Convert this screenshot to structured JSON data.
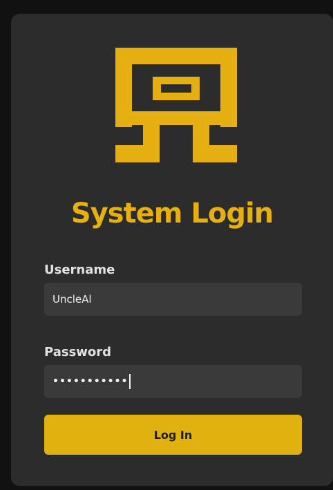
{
  "title": "System Login",
  "username": {
    "label": "Username",
    "value": "UncleAl"
  },
  "password": {
    "label": "Password",
    "masked_value": "•••••••••••"
  },
  "login_button": {
    "label": "Log In"
  },
  "colors": {
    "accent": "#e6b013",
    "card_background": "#2c2c2c",
    "field_background": "#3a3a3a",
    "label_text": "#e3e3e3"
  },
  "icons": {
    "logo": "pixel-arch-logo-icon"
  }
}
